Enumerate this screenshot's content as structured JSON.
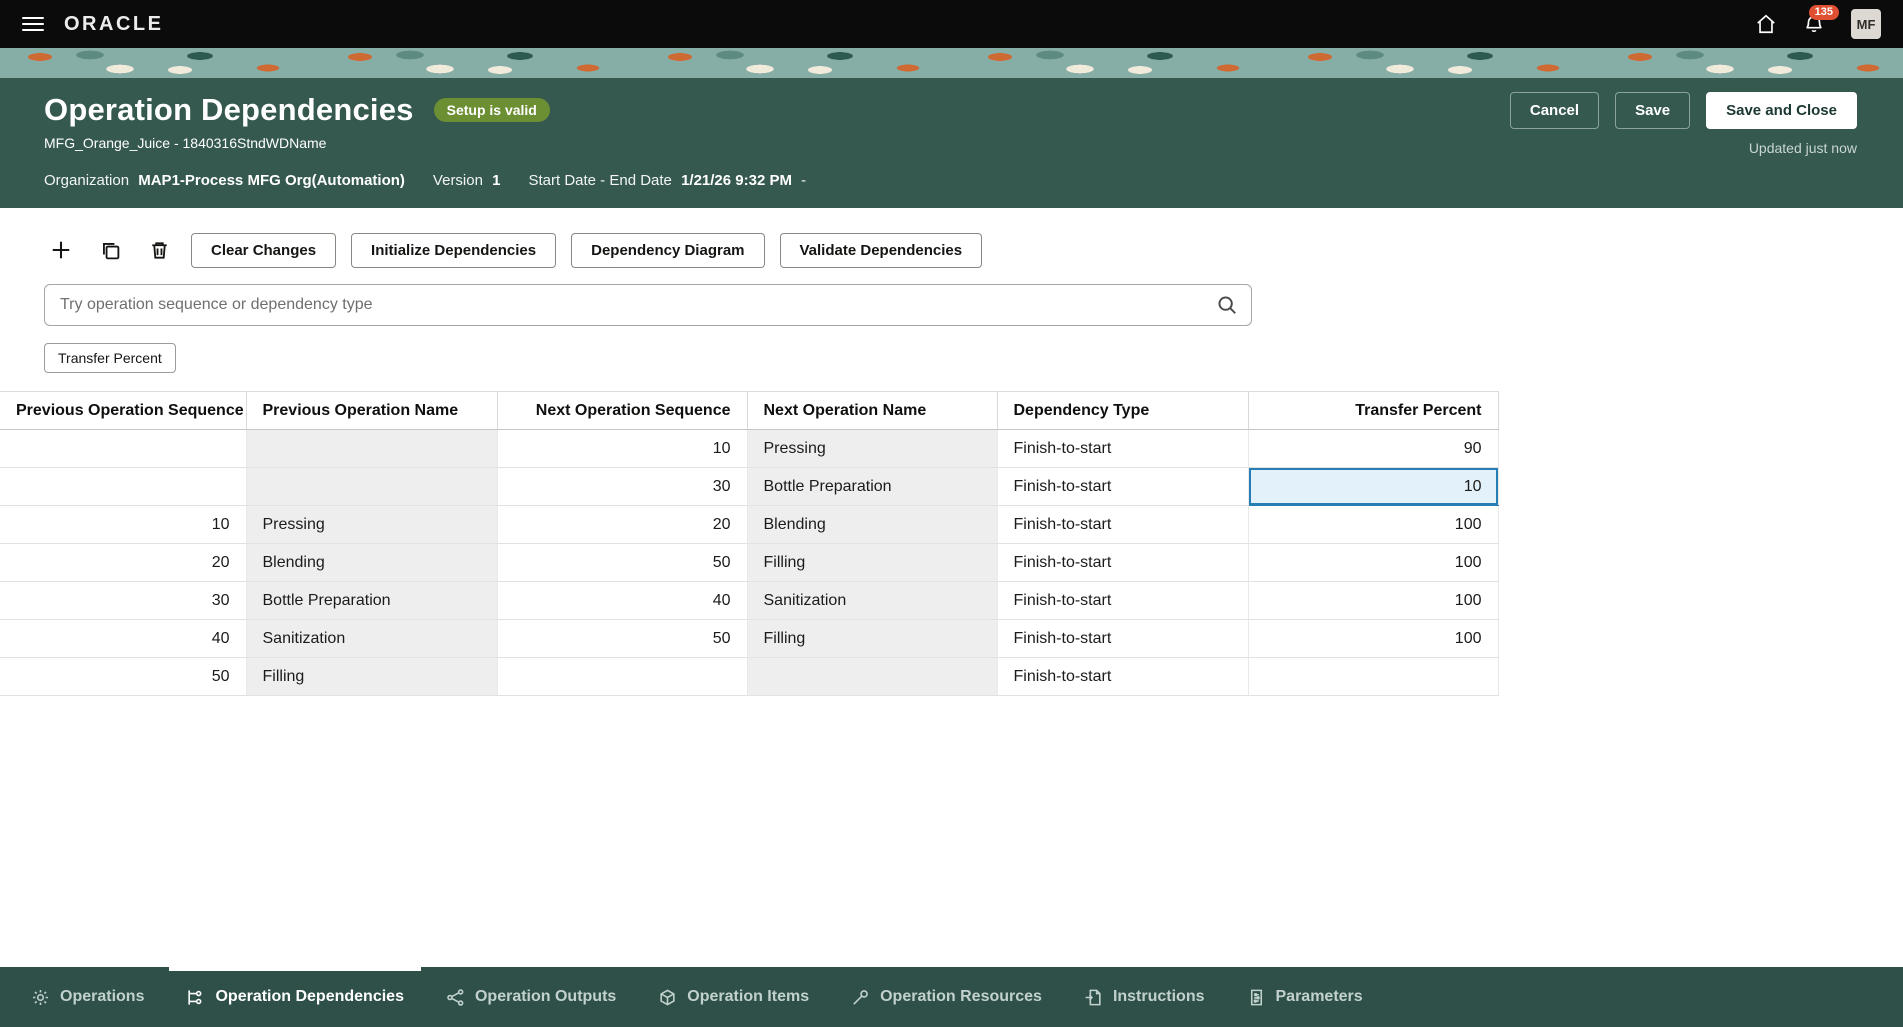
{
  "top_bar": {
    "logo": "ORACLE",
    "notification_count": "135",
    "avatar_initials": "MF"
  },
  "header": {
    "title": "Operation Dependencies",
    "status_badge": "Setup is valid",
    "subtitle": "MFG_Orange_Juice - 1840316StndWDName",
    "buttons": {
      "cancel": "Cancel",
      "save": "Save",
      "save_and_close": "Save and Close"
    },
    "updated": "Updated just now",
    "meta": {
      "organization_label": "Organization",
      "organization_value": "MAP1-Process MFG Org(Automation)",
      "version_label": "Version",
      "version_value": "1",
      "dates_label": "Start Date - End Date",
      "dates_value": "1/21/26 9:32 PM",
      "dates_suffix": "-"
    }
  },
  "toolbar": {
    "buttons": [
      "Clear Changes",
      "Initialize Dependencies",
      "Dependency Diagram",
      "Validate Dependencies"
    ],
    "search_placeholder": "Try operation sequence or dependency type",
    "filter_chip": "Transfer Percent"
  },
  "table": {
    "headers": [
      "Previous Operation Sequence",
      "Previous Operation Name",
      "Next Operation Sequence",
      "Next Operation Name",
      "Dependency Type",
      "Transfer Percent"
    ],
    "rows": [
      {
        "prev_seq": "",
        "prev_name": "",
        "next_seq": "10",
        "next_name": "Pressing",
        "dep_type": "Finish-to-start",
        "transfer_pct": "90"
      },
      {
        "prev_seq": "",
        "prev_name": "",
        "next_seq": "30",
        "next_name": "Bottle Preparation",
        "dep_type": "Finish-to-start",
        "transfer_pct": "10"
      },
      {
        "prev_seq": "10",
        "prev_name": "Pressing",
        "next_seq": "20",
        "next_name": "Blending",
        "dep_type": "Finish-to-start",
        "transfer_pct": "100"
      },
      {
        "prev_seq": "20",
        "prev_name": "Blending",
        "next_seq": "50",
        "next_name": "Filling",
        "dep_type": "Finish-to-start",
        "transfer_pct": "100"
      },
      {
        "prev_seq": "30",
        "prev_name": "Bottle Preparation",
        "next_seq": "40",
        "next_name": "Sanitization",
        "dep_type": "Finish-to-start",
        "transfer_pct": "100"
      },
      {
        "prev_seq": "40",
        "prev_name": "Sanitization",
        "next_seq": "50",
        "next_name": "Filling",
        "dep_type": "Finish-to-start",
        "transfer_pct": "100"
      },
      {
        "prev_seq": "50",
        "prev_name": "Filling",
        "next_seq": "",
        "next_name": "",
        "dep_type": "Finish-to-start",
        "transfer_pct": ""
      }
    ],
    "selected_cell": {
      "row_index": 1,
      "column": "Transfer Percent",
      "value": "10"
    }
  },
  "tabs": [
    {
      "label": "Operations",
      "active": false
    },
    {
      "label": "Operation Dependencies",
      "active": true
    },
    {
      "label": "Operation Outputs",
      "active": false
    },
    {
      "label": "Operation Items",
      "active": false
    },
    {
      "label": "Operation Resources",
      "active": false
    },
    {
      "label": "Instructions",
      "active": false
    },
    {
      "label": "Parameters",
      "active": false
    }
  ],
  "colors": {
    "header_teal": "#35594f",
    "bottom_bar_teal": "#2e5049",
    "status_badge_green": "#6c8f34",
    "notification_badge_red": "#e04f32",
    "selected_cell_border": "#277eb5",
    "selected_cell_bg": "#e3f1fa"
  }
}
